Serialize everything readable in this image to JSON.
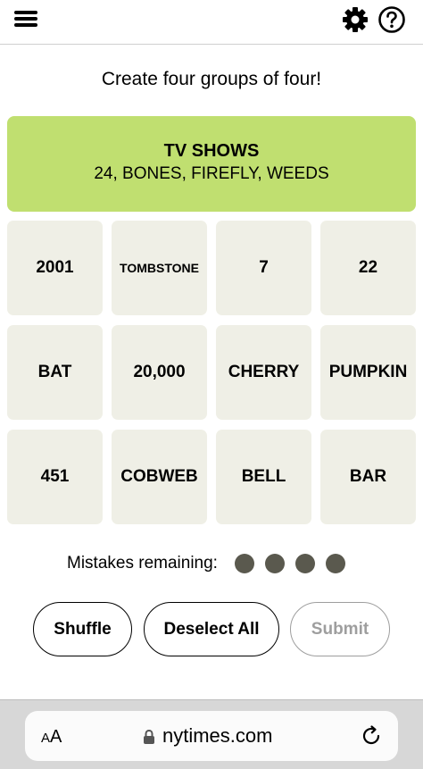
{
  "header": {
    "menu_icon": "hamburger-menu-icon",
    "settings_icon": "gear-icon",
    "help_icon": "question-circle-icon"
  },
  "instruction": "Create four groups of four!",
  "solved_group": {
    "title": "TV SHOWS",
    "members": "24, BONES, FIREFLY, WEEDS",
    "color": "#c0df70"
  },
  "tiles": [
    "2001",
    "TOMBSTONE",
    "7",
    "22",
    "BAT",
    "20,000",
    "CHERRY",
    "PUMPKIN",
    "451",
    "COBWEB",
    "BELL",
    "BAR"
  ],
  "mistakes": {
    "label": "Mistakes remaining:",
    "remaining": 4
  },
  "buttons": {
    "shuffle": "Shuffle",
    "deselect_all": "Deselect All",
    "submit": "Submit"
  },
  "browser": {
    "text_size_label_big": "A",
    "text_size_label_small": "A",
    "url": "nytimes.com"
  }
}
